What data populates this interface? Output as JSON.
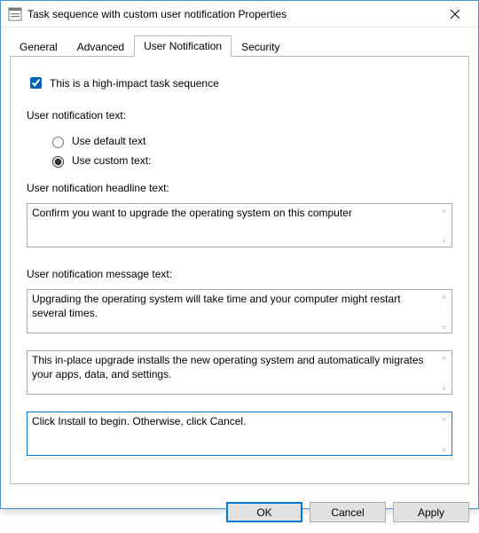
{
  "window": {
    "title": "Task sequence with custom user notification Properties"
  },
  "tabs": {
    "general": "General",
    "advanced": "Advanced",
    "user_notification": "User Notification",
    "security": "Security"
  },
  "panel": {
    "high_impact_label": "This is a high-impact task sequence",
    "high_impact_checked": true,
    "notification_text_label": "User notification text:",
    "radio_default": "Use default text",
    "radio_custom": "Use custom text:",
    "radio_selected": "custom",
    "headline_label": "User notification headline text:",
    "headline_value": "Confirm you want to upgrade the operating system on this computer",
    "message_label": "User notification message text:",
    "message1_value": "Upgrading the operating system will take time and your computer might restart several times.",
    "message2_value": "This in-place upgrade installs the new operating system and automatically migrates your apps, data, and settings.",
    "message3_value": "Click Install to begin. Otherwise, click Cancel."
  },
  "buttons": {
    "ok": "OK",
    "cancel": "Cancel",
    "apply": "Apply"
  }
}
